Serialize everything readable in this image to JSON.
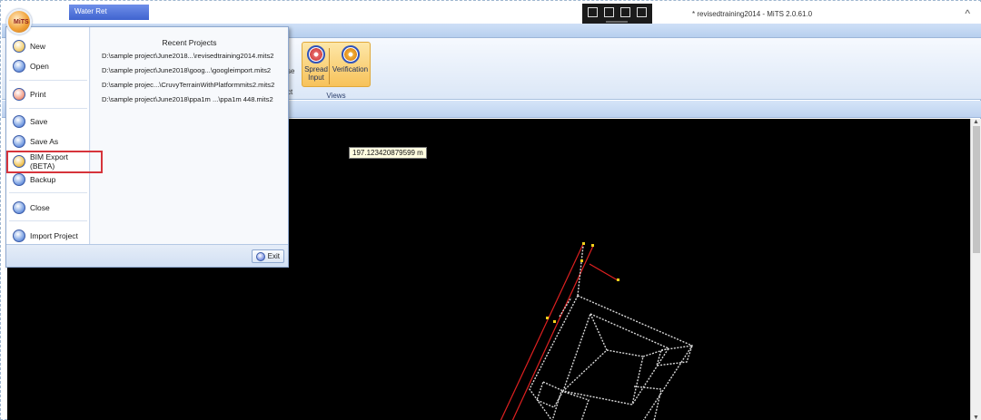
{
  "window": {
    "quick_access_tab": "Water Ret",
    "title": "* revisedtraining2014 - MiTS 2.0.61.0",
    "close_glyph": "^"
  },
  "ribbon": {
    "cut_label_1": "se",
    "cut_label_2": "ct",
    "views_group_label": "Views",
    "buttons": [
      {
        "label_line1": "Spread",
        "label_line2": "Input",
        "icon": "spread-input-icon"
      },
      {
        "label_line1": "Verification",
        "label_line2": "",
        "icon": "verification-icon"
      }
    ]
  },
  "app_button": {
    "logo": "MiTS"
  },
  "app_menu": {
    "items": [
      {
        "label": "New",
        "icon": "new-icon"
      },
      {
        "label": "Open",
        "icon": "open-icon"
      },
      {
        "label": "Print",
        "icon": "print-icon"
      },
      {
        "label": "Save",
        "icon": "save-icon"
      },
      {
        "label": "Save As",
        "icon": "save-as-icon"
      },
      {
        "label": "BIM Export (BETA)",
        "icon": "bim-export-icon"
      },
      {
        "label": "Backup",
        "icon": "backup-icon"
      },
      {
        "label": "Close",
        "icon": "close-icon"
      },
      {
        "label": "Import Project",
        "icon": "import-project-icon"
      }
    ],
    "highlighted_item": "BIM Export (BETA)",
    "highlight_color": "#d6343b",
    "recent_title": "Recent Projects",
    "recent_projects": [
      "D:\\sample project\\June2018...\\revisedtraining2014.mits2",
      "D:\\sample project\\June2018\\goog...\\googleimport.mits2",
      "D:\\sample projec...\\CruvyTerrainWithPlatformmits2.mits2",
      "D:\\sample project\\June2018\\ppa1m ...\\ppa1m 448.mits2"
    ],
    "exit_label": "Exit"
  },
  "canvas": {
    "measurement_label": "197.123420879599 m",
    "background": "#000000",
    "line_color": "#e02020",
    "structure_color": "#d8d8d8",
    "marker_color": "#f2d21b"
  }
}
